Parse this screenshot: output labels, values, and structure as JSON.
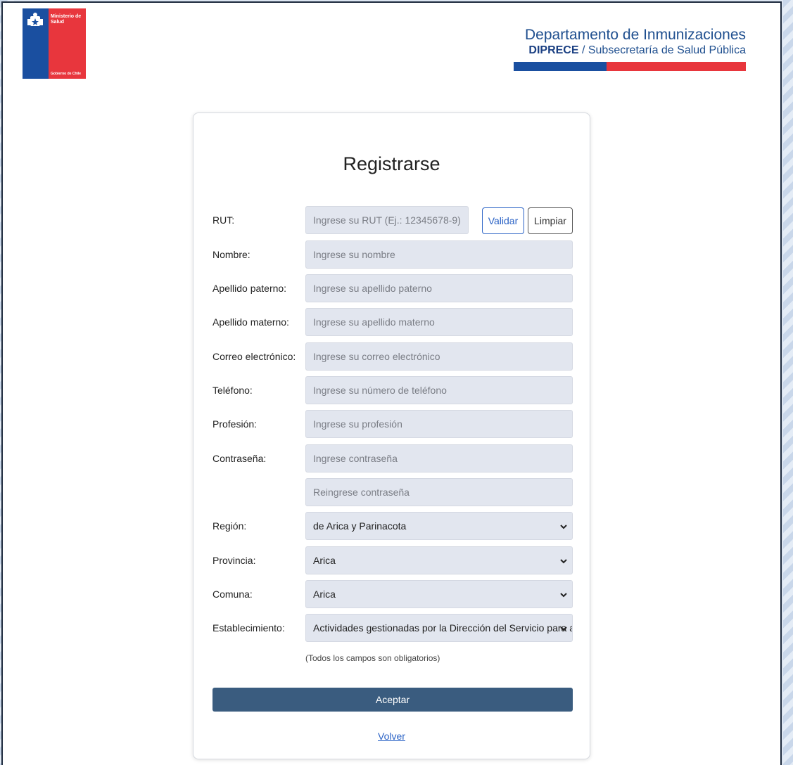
{
  "header": {
    "gov_ministry": "Ministerio de Salud",
    "gov_footer": "Gobierno de Chile",
    "dept_title": "Departamento de Inmunizaciones",
    "dept_sub_bold": "DIPRECE",
    "dept_sub_rest": " / Subsecretaría de Salud Pública"
  },
  "form": {
    "title": "Registrarse",
    "rut": {
      "label": "RUT:",
      "placeholder": "Ingrese su RUT (Ej.: 12345678-9)"
    },
    "validar_label": "Validar",
    "limpiar_label": "Limpiar",
    "nombre": {
      "label": "Nombre:",
      "placeholder": "Ingrese su nombre"
    },
    "apellido_paterno": {
      "label": "Apellido paterno:",
      "placeholder": "Ingrese su apellido paterno"
    },
    "apellido_materno": {
      "label": "Apellido materno:",
      "placeholder": "Ingrese su apellido materno"
    },
    "correo": {
      "label": "Correo electrónico:",
      "placeholder": "Ingrese su correo electrónico"
    },
    "telefono": {
      "label": "Teléfono:",
      "placeholder": "Ingrese su número de teléfono"
    },
    "profesion": {
      "label": "Profesión:",
      "placeholder": "Ingrese su profesión"
    },
    "contrasena": {
      "label": "Contraseña:",
      "placeholder": "Ingrese contraseña"
    },
    "recontrasena": {
      "placeholder": "Reingrese contraseña"
    },
    "region": {
      "label": "Región:",
      "value": "de Arica y Parinacota"
    },
    "provincia": {
      "label": "Provincia:",
      "value": "Arica"
    },
    "comuna": {
      "label": "Comuna:",
      "value": "Arica"
    },
    "establecimiento": {
      "label": "Establecimiento:",
      "value": "Actividades gestionadas por la Dirección del Servicio para a"
    },
    "note": "(Todos los campos son obligatorios)",
    "aceptar_label": "Aceptar",
    "volver_label": "Volver"
  },
  "colors": {
    "primary_button": "#3a5c7f",
    "input_bg": "#e2e6ef",
    "link": "#2b63c6",
    "gov_blue": "#1a4fa0",
    "gov_red": "#e8363d"
  }
}
